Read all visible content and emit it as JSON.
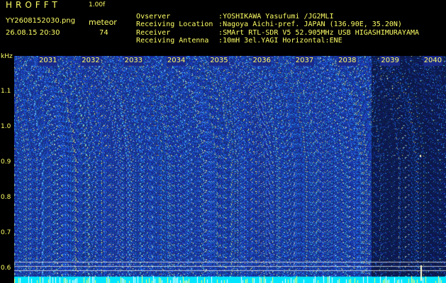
{
  "header": {
    "app_title": "HROFFT",
    "version": "1.00f",
    "filename": "YY2608152030.png",
    "datetime": "26.08.15 20:30",
    "meteor_label": "meteor",
    "meteor_count": "74"
  },
  "station_info": [
    {
      "key": "Ovserver",
      "value": ":YOSHIKAWA Yasufumi /JG2MLI"
    },
    {
      "key": "Receiving Location",
      "value": ":Nagoya Aichi-pref. JAPAN (136.90E, 35.20N)"
    },
    {
      "key": "Receiver",
      "value": ":SMArt RTL-SDR V5 52.905MHz USB HIGASHIMURAYAMA"
    },
    {
      "key": "Receiving Antenna",
      "value": ":10mH 3el.YAGI Horizontal:ENE"
    }
  ],
  "axis": {
    "unit": "kHz",
    "labels": [
      "1.1",
      "1.0",
      "0.9",
      "0.8",
      "0.7",
      "0.6"
    ],
    "values": [
      1.1,
      1.0,
      0.9,
      0.8,
      0.7,
      0.6
    ]
  },
  "minutes": [
    "2031",
    "2032",
    "2033",
    "2034",
    "2035",
    "2036",
    "2037",
    "2038",
    "2039",
    "2040"
  ],
  "colors": {
    "background": "#000000",
    "text": "#ffff66",
    "spectrum_base": "#1a2a8a",
    "baseline": "#00e5ff"
  }
}
